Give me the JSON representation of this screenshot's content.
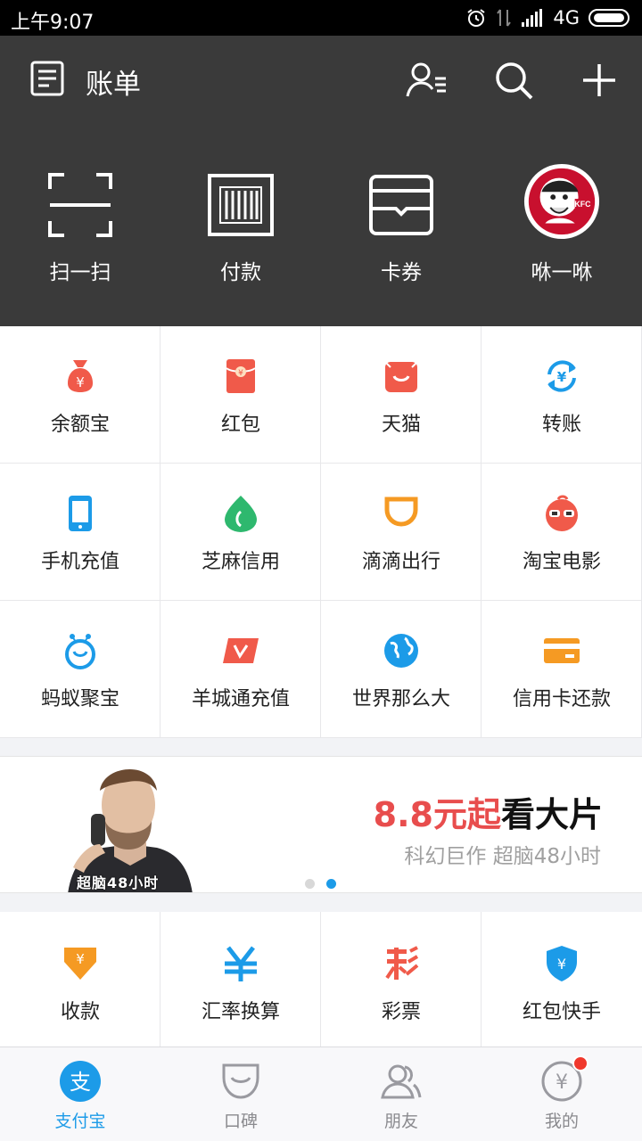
{
  "status": {
    "time": "上午9:07",
    "network": "4G"
  },
  "header": {
    "title": "账单"
  },
  "quick_actions": [
    {
      "label": "扫一扫"
    },
    {
      "label": "付款"
    },
    {
      "label": "卡券"
    },
    {
      "label": "咻一咻"
    }
  ],
  "grid": [
    {
      "label": "余额宝"
    },
    {
      "label": "红包"
    },
    {
      "label": "天猫"
    },
    {
      "label": "转账"
    },
    {
      "label": "手机充值"
    },
    {
      "label": "芝麻信用"
    },
    {
      "label": "滴滴出行"
    },
    {
      "label": "淘宝电影"
    },
    {
      "label": "蚂蚁聚宝"
    },
    {
      "label": "羊城通充值"
    },
    {
      "label": "世界那么大"
    },
    {
      "label": "信用卡还款"
    }
  ],
  "banner": {
    "headline_red": "8.8元起",
    "headline_dark": "看大片",
    "subtitle": "科幻巨作 超脑48小时",
    "caption": "超脑48小时",
    "active_dot": 2,
    "dot_count": 2
  },
  "grid2": [
    {
      "label": "收款"
    },
    {
      "label": "汇率换算"
    },
    {
      "label": "彩票"
    },
    {
      "label": "红包快手"
    }
  ],
  "tabs": [
    {
      "label": "支付宝",
      "active": true
    },
    {
      "label": "口碑",
      "active": false
    },
    {
      "label": "朋友",
      "active": false
    },
    {
      "label": "我的",
      "active": false
    }
  ],
  "colors": {
    "accent": "#1c9be8",
    "header_bg": "#3a3a3a",
    "badge": "#f0382c"
  }
}
